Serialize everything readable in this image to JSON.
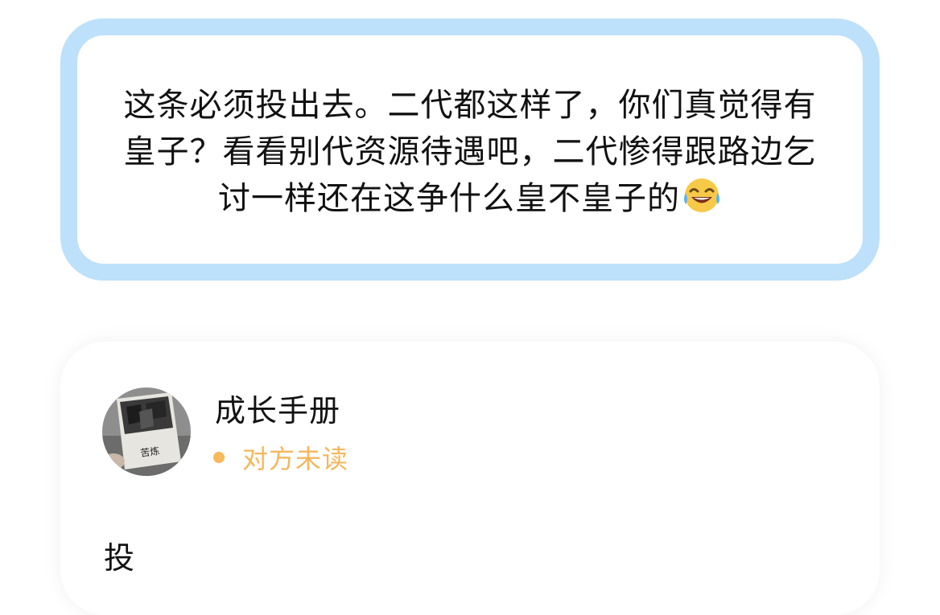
{
  "quote": {
    "text": "这条必须投出去。二代都这样了，你们真觉得有皇子？看看别代资源待遇吧，二代惨得跟路边乞讨一样还在这争什么皇不皇子的",
    "emoji": "face-with-tears-of-joy-icon"
  },
  "message": {
    "sender_name": "成长手册",
    "read_status": "对方未读",
    "body": "投",
    "avatar_cover_text": "苦炼"
  },
  "colors": {
    "quote_border": "#bde0fb",
    "status_dot": "#f8b95a",
    "status_text": "#f4b75d",
    "text": "#111111"
  }
}
